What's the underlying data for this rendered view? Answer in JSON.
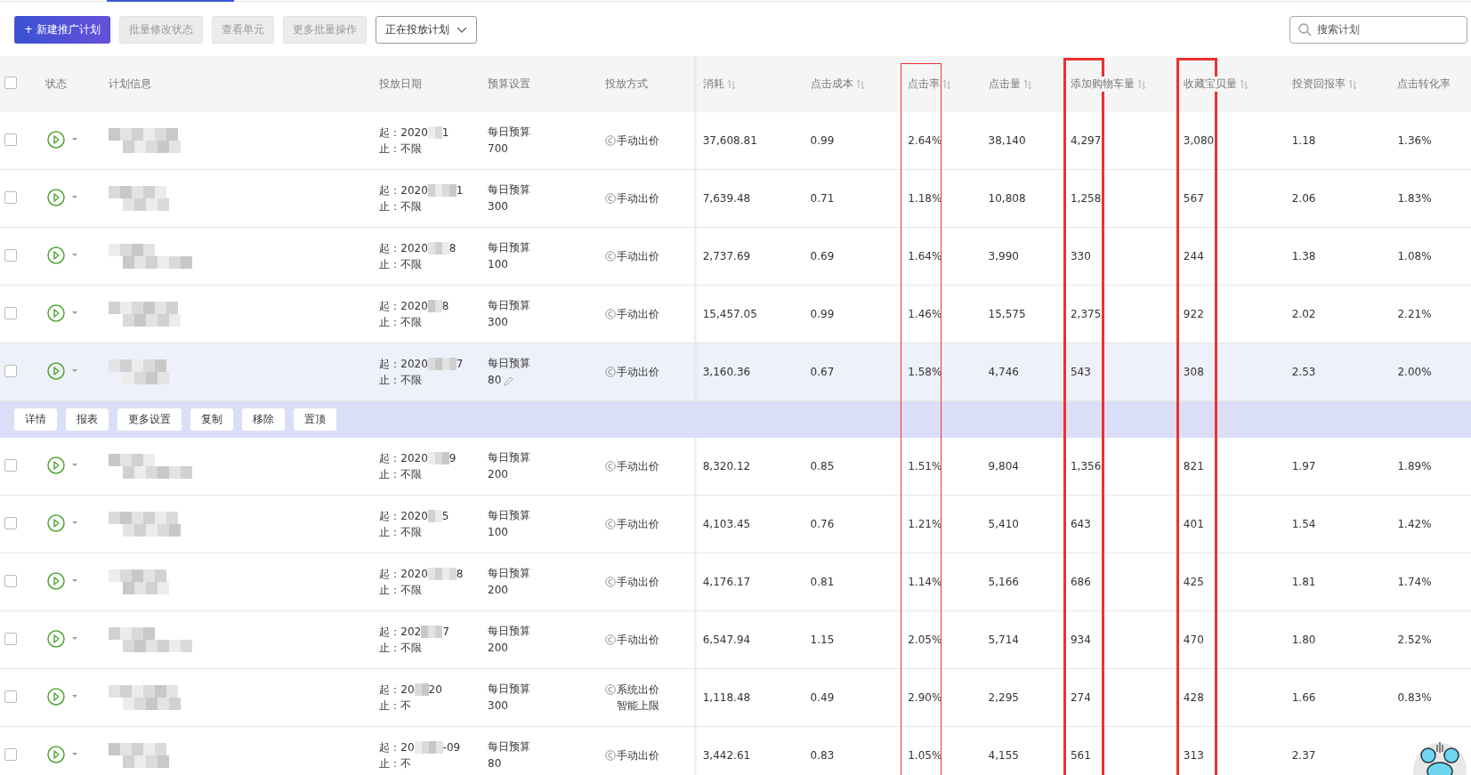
{
  "toolbar": {
    "buttons": [
      {
        "label": "+ 新建推广计划",
        "kind": "primary"
      },
      {
        "label": "批量修改状态",
        "kind": "plain",
        "disabled": true
      },
      {
        "label": "查看单元",
        "kind": "plain",
        "disabled": true
      },
      {
        "label": "更多批量操作",
        "kind": "plain",
        "disabled": true
      }
    ],
    "filter": {
      "value": "正在投放计划"
    },
    "search": {
      "placeholder": "搜索计划"
    }
  },
  "table": {
    "header_checked": false,
    "columns": [
      {
        "label": "状态",
        "sortable": false,
        "kind": "plain"
      },
      {
        "label": "计划信息",
        "sortable": false,
        "kind": "plain"
      },
      {
        "label": "投放日期",
        "sortable": false,
        "kind": "plain"
      },
      {
        "label": "预算设置",
        "sortable": false,
        "kind": "plain"
      },
      {
        "label": "投放方式",
        "sortable": false,
        "kind": "plain"
      },
      {
        "label": "消耗",
        "sortable": true,
        "kind": "plain"
      },
      {
        "label": "点击成本",
        "sortable": true,
        "kind": "plain"
      },
      {
        "label": "点击率",
        "sortable": true,
        "kind": "framed"
      },
      {
        "label": "点击量",
        "sortable": true,
        "kind": "plain"
      },
      {
        "label": "添加购物车量",
        "sortable": true,
        "kind": "boldframed"
      },
      {
        "label": "收藏宝贝量",
        "sortable": true,
        "kind": "boldframed"
      },
      {
        "label": "投资回报率",
        "sortable": true,
        "kind": "plain"
      },
      {
        "label": "点击转化率",
        "sortable": false,
        "kind": "plain"
      }
    ],
    "rows": [
      {
        "checked": false,
        "hovered": false,
        "date_start": [
          "起：2020",
          "1"
        ],
        "date_end": "止：不限",
        "budget_label": "每日预算",
        "budget": "700",
        "method": [
          "手动出价"
        ],
        "metrics": [
          "37,608.81",
          "0.99",
          "2.64%",
          "38,140",
          "4,297",
          "3,080",
          "1.18",
          "1.36%"
        ]
      },
      {
        "checked": false,
        "hovered": false,
        "date_start": [
          "起：2020",
          "1"
        ],
        "date_end": "止：不限",
        "budget_label": "每日预算",
        "budget": "300",
        "method": [
          "手动出价"
        ],
        "metrics": [
          "7,639.48",
          "0.71",
          "1.18%",
          "10,808",
          "1,258",
          "567",
          "2.06",
          "1.83%"
        ]
      },
      {
        "checked": false,
        "hovered": false,
        "date_start": [
          "起：2020",
          "8"
        ],
        "date_end": "止：不限",
        "budget_label": "每日预算",
        "budget": "100",
        "method": [
          "手动出价"
        ],
        "metrics": [
          "2,737.69",
          "0.69",
          "1.64%",
          "3,990",
          "330",
          "244",
          "1.38",
          "1.08%"
        ]
      },
      {
        "checked": false,
        "hovered": false,
        "date_start": [
          "起：2020",
          "8"
        ],
        "date_end": "止：不限",
        "budget_label": "每日预算",
        "budget": "300",
        "method": [
          "手动出价"
        ],
        "metrics": [
          "15,457.05",
          "0.99",
          "1.46%",
          "15,575",
          "2,375",
          "922",
          "2.02",
          "2.21%"
        ]
      },
      {
        "checked": false,
        "hovered": true,
        "date_start": [
          "起：2020",
          "7"
        ],
        "date_end": "止：不限",
        "budget_label": "每日预算",
        "budget": "80",
        "method": [
          "手动出价"
        ],
        "metrics": [
          "3,160.36",
          "0.67",
          "1.58%",
          "4,746",
          "543",
          "308",
          "2.53",
          "2.00%"
        ],
        "actions": [
          "详情",
          "报表",
          "更多设置",
          "复制",
          "移除",
          "置顶"
        ]
      },
      {
        "checked": false,
        "hovered": false,
        "date_start": [
          "起：2020",
          "9"
        ],
        "date_end": "止：不限",
        "budget_label": "每日预算",
        "budget": "200",
        "method": [
          "手动出价"
        ],
        "metrics": [
          "8,320.12",
          "0.85",
          "1.51%",
          "9,804",
          "1,356",
          "821",
          "1.97",
          "1.89%"
        ]
      },
      {
        "checked": false,
        "hovered": false,
        "date_start": [
          "起：2020",
          "5"
        ],
        "date_end": "止：不限",
        "budget_label": "每日预算",
        "budget": "100",
        "method": [
          "手动出价"
        ],
        "metrics": [
          "4,103.45",
          "0.76",
          "1.21%",
          "5,410",
          "643",
          "401",
          "1.54",
          "1.42%"
        ]
      },
      {
        "checked": false,
        "hovered": false,
        "date_start": [
          "起：2020",
          "8"
        ],
        "date_end": "止：不限",
        "budget_label": "每日预算",
        "budget": "200",
        "method": [
          "手动出价"
        ],
        "metrics": [
          "4,176.17",
          "0.81",
          "1.14%",
          "5,166",
          "686",
          "425",
          "1.81",
          "1.74%"
        ]
      },
      {
        "checked": false,
        "hovered": false,
        "date_start": [
          "起：202",
          "7"
        ],
        "date_end": "止：不限",
        "budget_label": "每日预算",
        "budget": "200",
        "method": [
          "手动出价"
        ],
        "metrics": [
          "6,547.94",
          "1.15",
          "2.05%",
          "5,714",
          "934",
          "470",
          "1.80",
          "2.52%"
        ]
      },
      {
        "checked": false,
        "hovered": false,
        "date_start": [
          "起：20",
          "20"
        ],
        "date_end": "止：不",
        "budget_label": "每日预算",
        "budget": "300",
        "method": [
          "系统出价",
          "智能上限"
        ],
        "metrics": [
          "1,118.48",
          "0.49",
          "2.90%",
          "2,295",
          "274",
          "428",
          "1.66",
          "0.83%"
        ]
      },
      {
        "checked": false,
        "hovered": false,
        "date_start": [
          "起：20",
          "-09"
        ],
        "date_end": "止：不",
        "budget_label": "每日预算",
        "budget": "80",
        "method": [
          "手动出价"
        ],
        "metrics": [
          "3,442.61",
          "0.83",
          "1.05%",
          "4,155",
          "561",
          "313",
          "2.37"
        ]
      }
    ]
  }
}
